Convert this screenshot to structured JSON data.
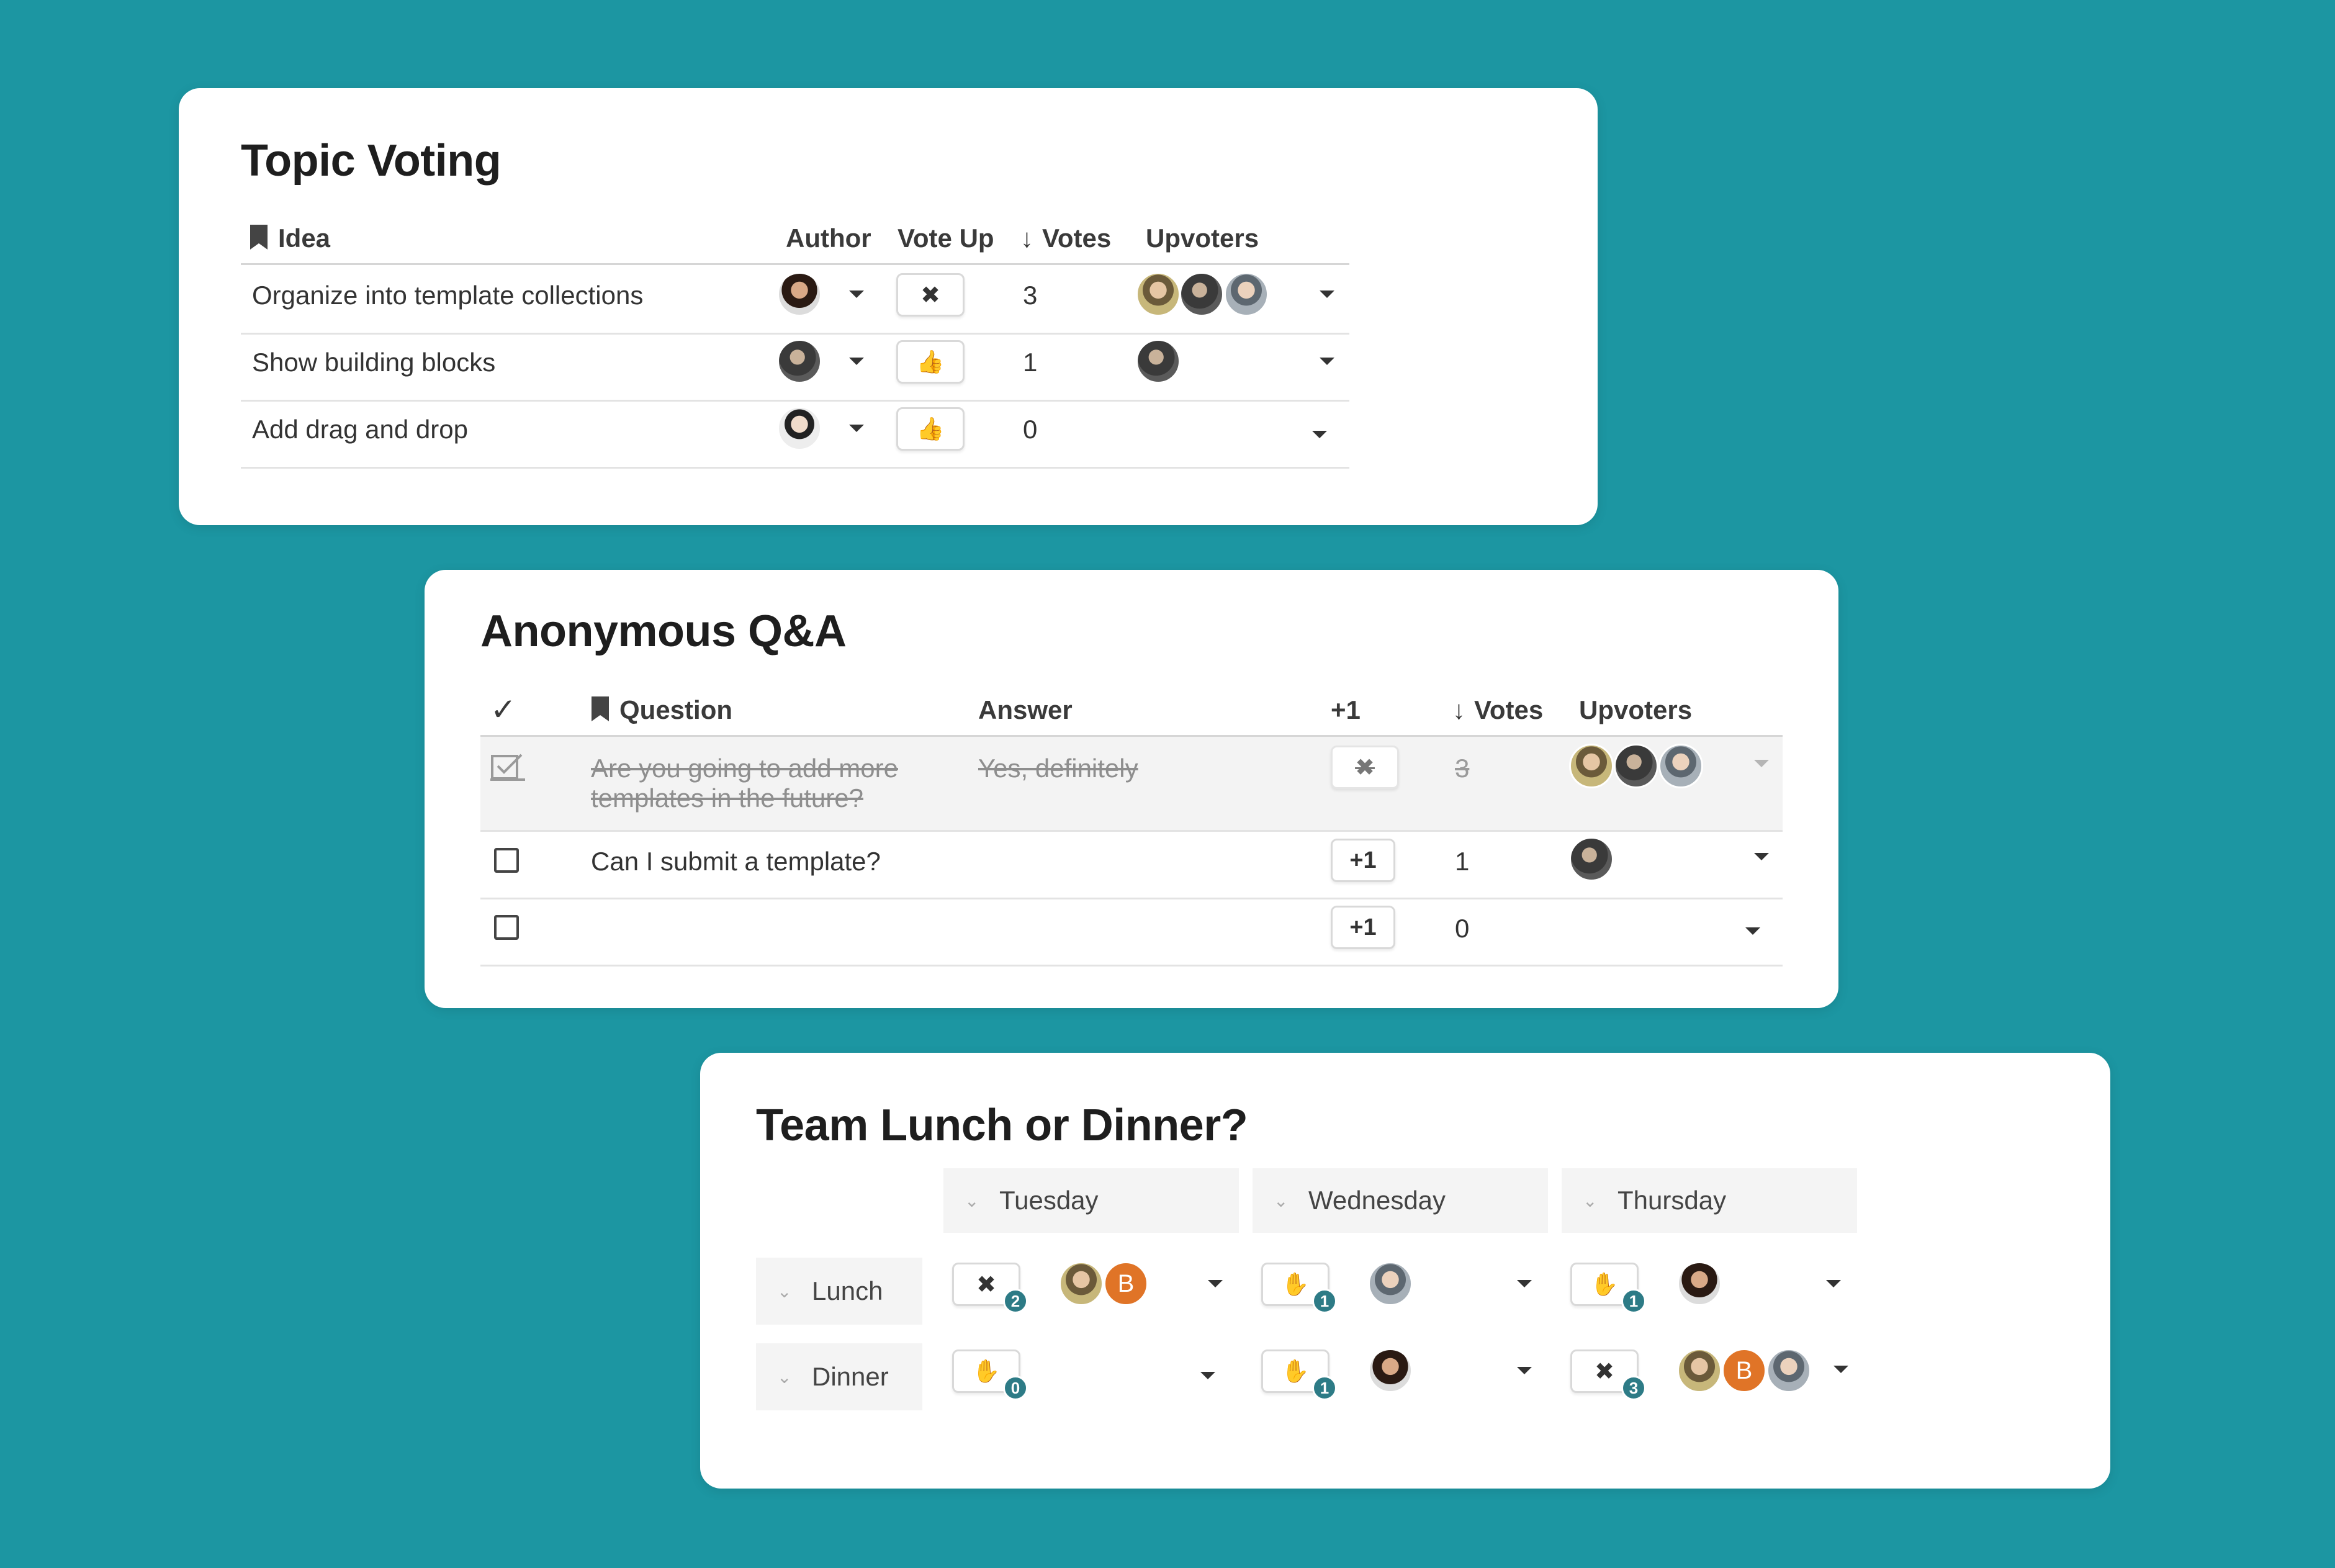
{
  "topic_voting": {
    "title": "Topic Voting",
    "columns": {
      "idea": "Idea",
      "author": "Author",
      "vote_up": "Vote Up",
      "votes": "Votes",
      "upvoters": "Upvoters"
    },
    "rows": [
      {
        "idea": "Organize into template collections",
        "vote_button": "✖",
        "votes": "3"
      },
      {
        "idea": "Show building blocks",
        "vote_button": "👍",
        "votes": "1"
      },
      {
        "idea": "Add drag and drop",
        "vote_button": "👍",
        "votes": "0"
      }
    ]
  },
  "qa": {
    "title": "Anonymous Q&A",
    "columns": {
      "done": "✓",
      "question": "Question",
      "answer": "Answer",
      "plus_one": "+1",
      "votes": "Votes",
      "upvoters": "Upvoters"
    },
    "rows": [
      {
        "question": "Are you going to add more templates in the future?",
        "question_line1": "Are you going to add more",
        "question_line2": "templates in the future?",
        "answer": "Yes, definitely",
        "button": "✖",
        "votes": "3",
        "checked": true
      },
      {
        "question": "Can I submit a template?",
        "answer": "",
        "button": "+1",
        "votes": "1",
        "checked": false
      },
      {
        "question": "",
        "answer": "",
        "button": "+1",
        "votes": "0",
        "checked": false
      }
    ]
  },
  "lunch": {
    "title": "Team Lunch or Dinner?",
    "days": [
      "Tuesday",
      "Wednesday",
      "Thursday"
    ],
    "meals": [
      "Lunch",
      "Dinner"
    ],
    "cells": {
      "lunch": [
        {
          "button": "✖",
          "count": "2",
          "avatar_letter": "B"
        },
        {
          "button": "✋",
          "count": "1"
        },
        {
          "button": "✋",
          "count": "1"
        }
      ],
      "dinner": [
        {
          "button": "✋",
          "count": "0"
        },
        {
          "button": "✋",
          "count": "1"
        },
        {
          "button": "✖",
          "count": "3",
          "avatar_letter": "B"
        }
      ]
    }
  }
}
